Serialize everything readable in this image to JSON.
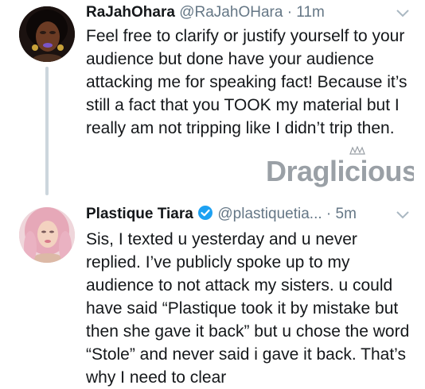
{
  "tweets": [
    {
      "display_name": "RaJahOhara",
      "handle": "@RaJahOHara",
      "separator": "·",
      "time": "11m",
      "text": "Feel free to clarify or justify yourself to your audience but done have your audience attacking me for speaking fact! Because it’s still a fact that you TOOK my material but I really am not tripping like I didn’t trip then.",
      "avatar_icon": "avatar-dark-hair-purple-lips",
      "menu_icon": "chevron-down-icon"
    },
    {
      "display_name": "Plastique Tiara",
      "verified": true,
      "handle": "@plastiquetia...",
      "separator": "·",
      "time": "5m",
      "text": "Sis, I texted u yesterday and u never replied. I’ve publicly spoke up to my audience to not attack my sisters. u could have said “Plastique took it by mistake but then she gave it back” but u chose the word “Stole” and never said i gave it back. That’s why I need to clear",
      "avatar_icon": "avatar-pink-hair",
      "menu_icon": "chevron-down-icon"
    }
  ],
  "watermark": {
    "text": "Draglicious",
    "icon": "crown-icon"
  },
  "colors": {
    "text": "#14171a",
    "secondary": "#657786",
    "verified": "#1da1f2",
    "thread_line": "#ccd6dd",
    "watermark": "#9aa0a6"
  }
}
